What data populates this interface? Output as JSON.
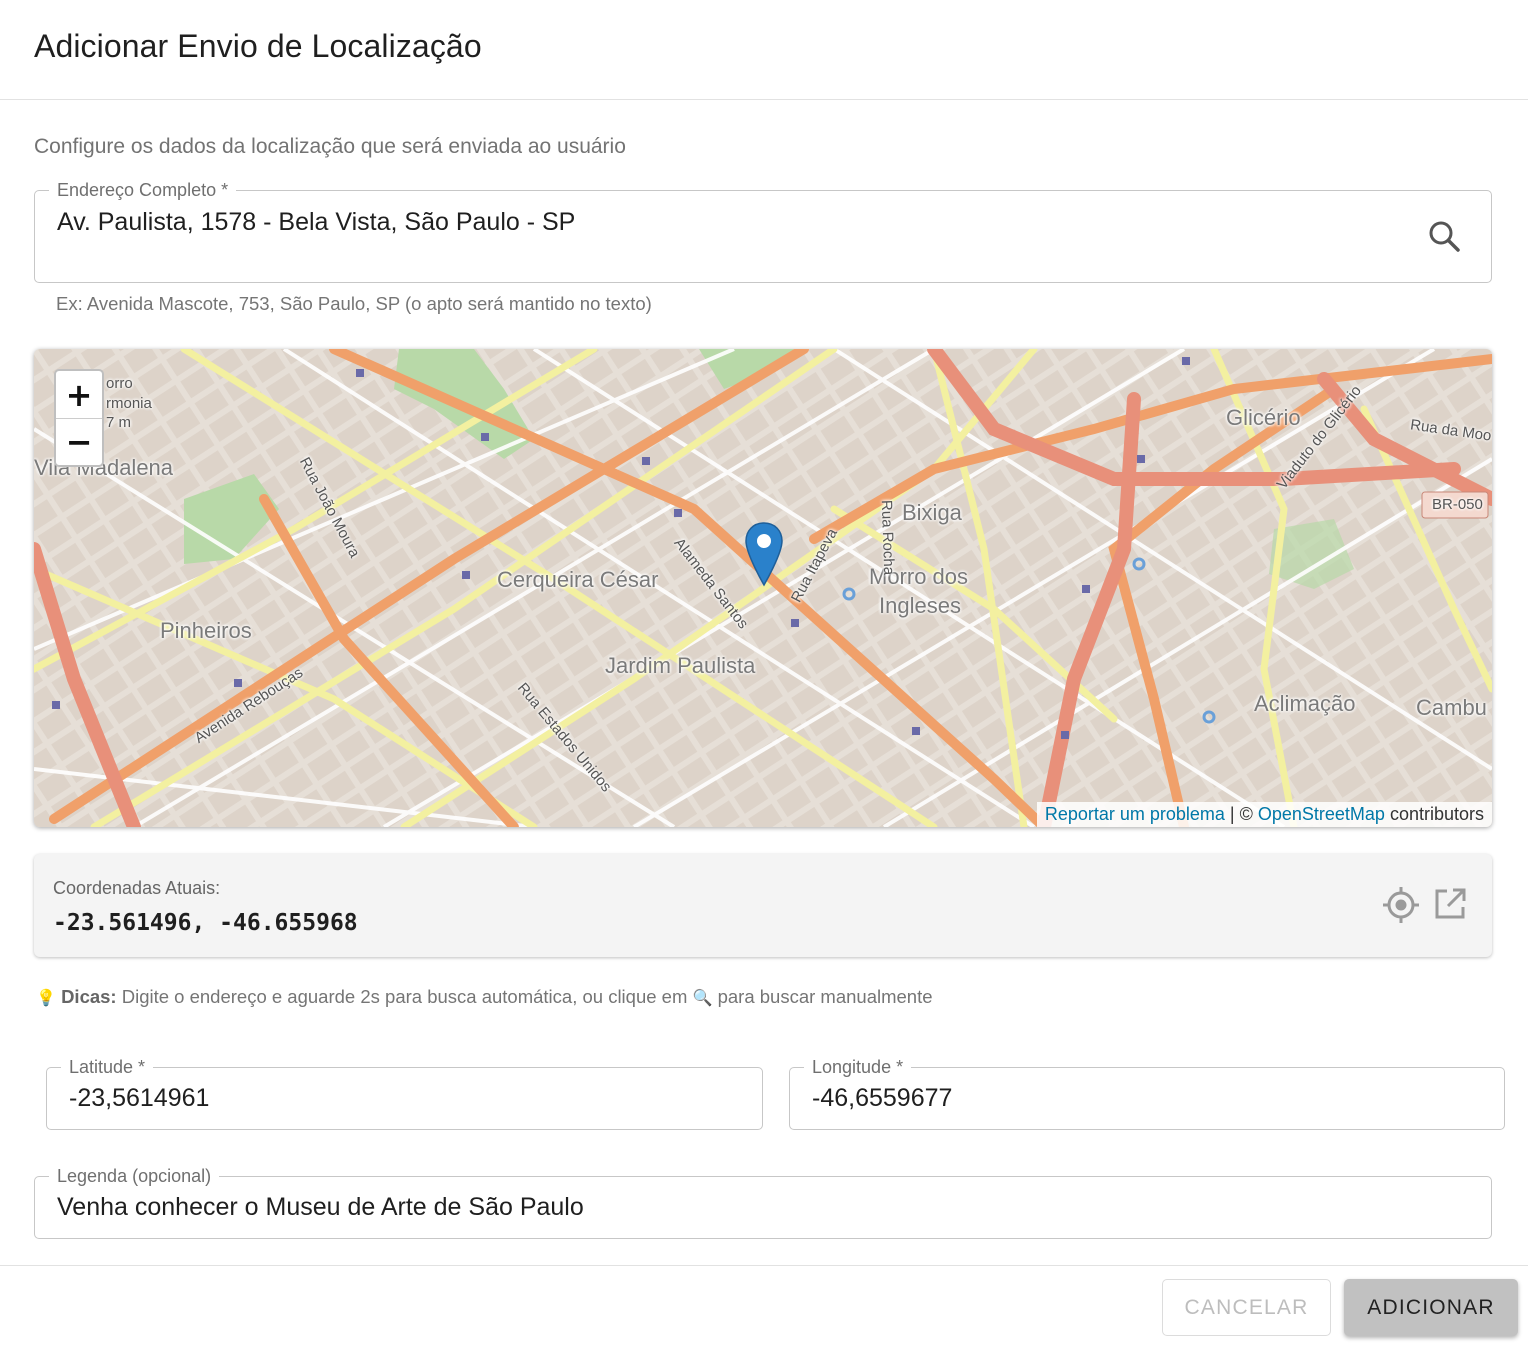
{
  "dialog": {
    "title": "Adicionar Envio de Localização",
    "subtitle": "Configure os dados da localização que será enviada ao usuário"
  },
  "address": {
    "label": "Endereço Completo *",
    "value": "Av. Paulista, 1578 - Bela Vista, São Paulo - SP",
    "helper": "Ex: Avenida Mascote, 753, São Paulo, SP (o apto será mantido no texto)",
    "search_icon": "search-icon"
  },
  "map": {
    "zoom_in": "+",
    "zoom_out": "−",
    "attribution": {
      "report": "Reportar um problema",
      "separator": " | © ",
      "osm": "OpenStreetMap",
      "contributors": " contributors"
    },
    "labels": {
      "vila_madalena": "Vila Madalena",
      "pinheiros": "Pinheiros",
      "cerqueira_cesar": "Cerqueira César",
      "jardim_paulista": "Jardim Paulista",
      "bixiga": "Bixiga",
      "morro_dos": "Morro dos",
      "ingleses": "Ingleses",
      "glicerio": "Glicério",
      "aclimacao": "Aclimação",
      "cambu": "Cambu",
      "br050": "BR-050",
      "rua_joao_moura": "Rua João Moura",
      "alameda_santos": "Alameda Santos",
      "rua_itapeva": "Rua Itapeva",
      "rua_rocha": "Rua Rocha",
      "avenida_reboucas": "Avenida Rebouças",
      "rua_estados_unidos": "Rua Estados Unidos",
      "viaduto_glicerio": "Viaduto do Glicério",
      "rua_da_mooca": "Rua da Moo",
      "morro_harmonia_1": "orro",
      "morro_harmonia_2": "rmonia",
      "morro_harmonia_3": "7 m"
    },
    "marker_icon": "map-marker-icon"
  },
  "coordinates": {
    "label": "Coordenadas Atuais:",
    "value": "-23.561496, -46.655968",
    "locate_icon": "crosshair-icon",
    "open_icon": "open-external-icon"
  },
  "tips": {
    "icon": "💡",
    "title": "Dicas:",
    "text_before": " Digite o endereço e aguarde 2s para busca automática, ou clique em ",
    "search_glyph": "🔍",
    "text_after": " para buscar manualmente"
  },
  "latitude": {
    "label": "Latitude *",
    "value": "-23,5614961"
  },
  "longitude": {
    "label": "Longitude *",
    "value": "-46,6559677"
  },
  "caption": {
    "label": "Legenda (opcional)",
    "value": "Venha conhecer o Museu de Arte de São Paulo"
  },
  "buttons": {
    "cancel": "CANCELAR",
    "add": "ADICIONAR"
  },
  "colors": {
    "accent_marker": "#2a81cb",
    "link": "#0078a8",
    "primary_road": "#f0a06a",
    "secondary_road": "#f3f0a0",
    "park": "#b8d9a8"
  }
}
